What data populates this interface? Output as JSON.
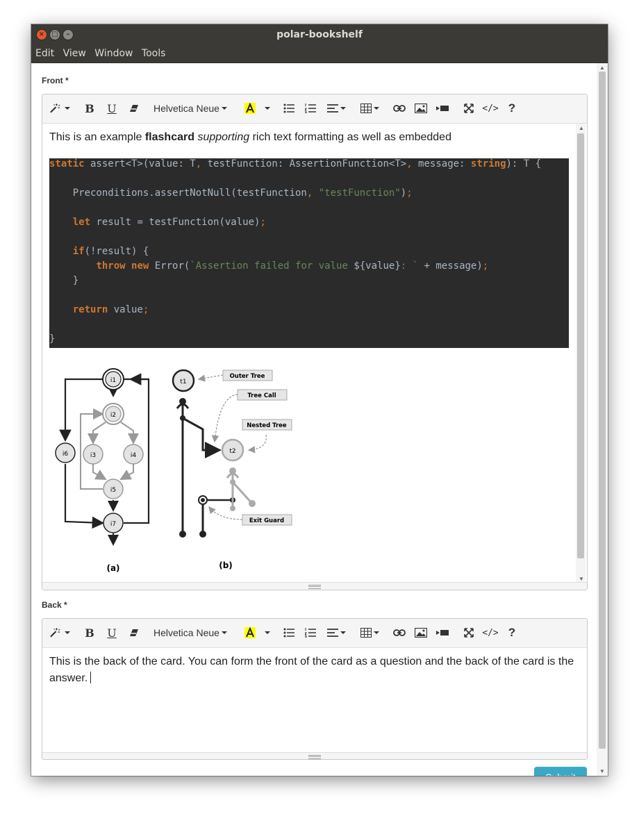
{
  "window": {
    "title": "polar-bookshelf"
  },
  "menu": [
    "Edit",
    "View",
    "Window",
    "Tools"
  ],
  "front": {
    "label": "Front *",
    "font": "Helvetica Neue",
    "intro": {
      "text1": "This is an example ",
      "bold": "flashcard",
      "sp1": " ",
      "italic": "supporting",
      "text2": " rich text formatting as well as embedded"
    },
    "code_lines": [
      "static assert<T>(value: T, testFunction: AssertionFunction<T>, message: string): T {",
      "",
      "    Preconditions.assertNotNull(testFunction, \"testFunction\");",
      "",
      "    let result = testFunction(value);",
      "",
      "    if(!result) {",
      "        throw new Error(`Assertion failed for value ${value}: ` + message);",
      "    }",
      "",
      "    return value;",
      "",
      "}"
    ],
    "diagram": {
      "a_nodes": [
        "i1",
        "i2",
        "i3",
        "i4",
        "i5",
        "i6",
        "i7"
      ],
      "b_nodes": [
        "t1",
        "t2"
      ],
      "b_labels": [
        "Outer Tree",
        "Tree Call",
        "Nested Tree",
        "Exit Guard"
      ],
      "caption_a": "(a)",
      "caption_b": "(b)"
    }
  },
  "back": {
    "label": "Back *",
    "font": "Helvetica Neue",
    "text": "This is the back of the card. You can form the front of the card as a question and the back of the card is the answer."
  },
  "submit_label": "Submit",
  "colors": {
    "titlebar": "#3b3a36",
    "code_bg": "#2b2b2b",
    "keyword": "#cc7832",
    "string": "#6a8759",
    "submit": "#3aa8c7"
  }
}
